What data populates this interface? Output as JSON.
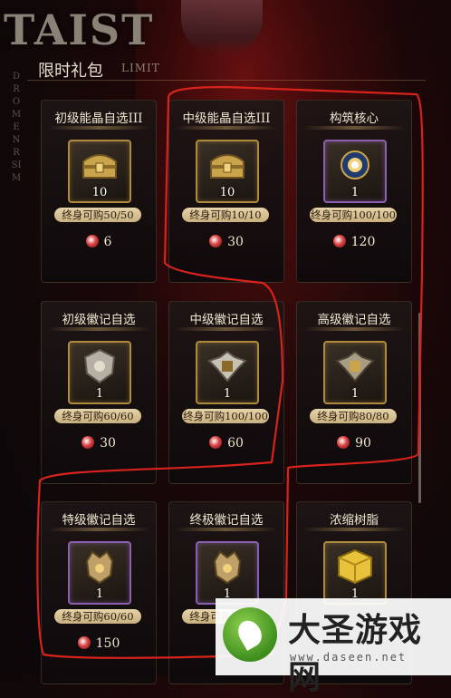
{
  "header": {
    "logo": "TAIST",
    "title": "限时礼包",
    "subtitle": "LIMIT",
    "side_text": "DROMENRSIM"
  },
  "cards": [
    {
      "title": "初级能晶自选III",
      "item": "treasure-chest",
      "count": "10",
      "limit": "终身可购50/50",
      "price": "6",
      "rarity": "gold"
    },
    {
      "title": "中级能晶自选III",
      "item": "treasure-chest",
      "count": "10",
      "limit": "终身可购10/10",
      "price": "30",
      "rarity": "gold"
    },
    {
      "title": "构筑核心",
      "item": "core-orb",
      "count": "1",
      "limit": "终身可购100/100",
      "price": "120",
      "rarity": "purple"
    },
    {
      "title": "初级徽记自选",
      "item": "emblem-shield",
      "count": "1",
      "limit": "终身可购60/60",
      "price": "30",
      "rarity": "gold"
    },
    {
      "title": "中级徽记自选",
      "item": "emblem-winged",
      "count": "1",
      "limit": "终身可购100/100",
      "price": "60",
      "rarity": "gold"
    },
    {
      "title": "高级徽记自选",
      "item": "emblem-winged",
      "count": "1",
      "limit": "终身可购80/80",
      "price": "90",
      "rarity": "gold"
    },
    {
      "title": "特级徽记自选",
      "item": "emblem-crown",
      "count": "1",
      "limit": "终身可购60/60",
      "price": "150",
      "rarity": "purple"
    },
    {
      "title": "终极徽记自选",
      "item": "emblem-crown",
      "count": "1",
      "limit": "终身可购60/60",
      "price": "",
      "rarity": "purple"
    },
    {
      "title": "浓缩树脂",
      "item": "resin-cube",
      "count": "1",
      "limit": "",
      "price": "",
      "rarity": "gold"
    }
  ],
  "watermark": {
    "title": "大圣游戏网",
    "url": "www.daseen.net"
  },
  "colors": {
    "accent_gold": "#b08a3c",
    "accent_purple": "#8a5fb0",
    "tag_bg": "#e6d3a8",
    "annotation_red": "#d8231c"
  }
}
